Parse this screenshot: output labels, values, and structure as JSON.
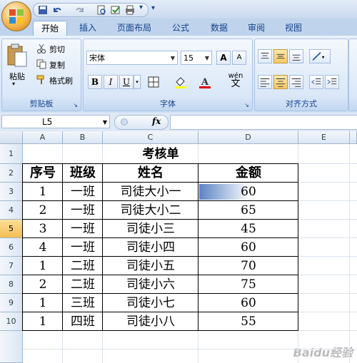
{
  "qat": {
    "dropdown_label": "₹"
  },
  "tabs": [
    "开始",
    "插入",
    "页面布局",
    "公式",
    "数据",
    "审阅",
    "视图"
  ],
  "ribbon": {
    "clipboard": {
      "paste": "粘贴",
      "cut": "剪切",
      "copy": "复制",
      "format_painter": "格式刷",
      "label": "剪贴板"
    },
    "font": {
      "font_name": "宋体",
      "font_size": "15",
      "grow": "A",
      "shrink": "A",
      "bold": "B",
      "italic": "I",
      "underline": "U",
      "phonetic": "wén",
      "phonetic_char": "文",
      "label": "字体"
    },
    "align": {
      "label": "对齐方式"
    }
  },
  "formula_bar": {
    "name_box": "L5",
    "fx": "fx",
    "formula": ""
  },
  "columns": [
    "A",
    "B",
    "C",
    "D",
    "E"
  ],
  "rows": [
    "1",
    "2",
    "3",
    "4",
    "5",
    "6",
    "7",
    "8",
    "9",
    "10"
  ],
  "selected_row": "5",
  "sheet": {
    "title": "考核单",
    "headers": [
      "序号",
      "班级",
      "姓名",
      "金额"
    ],
    "records": [
      {
        "no": "1",
        "cls": "一班",
        "name": "司徒大小一",
        "amount": "60"
      },
      {
        "no": "2",
        "cls": "一班",
        "name": "司徒大小二",
        "amount": "65"
      },
      {
        "no": "3",
        "cls": "一班",
        "name": "司徒小三",
        "amount": "45"
      },
      {
        "no": "4",
        "cls": "一班",
        "name": "司徒小四",
        "amount": "60"
      },
      {
        "no": "1",
        "cls": "二班",
        "name": "司徒小五",
        "amount": "70"
      },
      {
        "no": "2",
        "cls": "二班",
        "name": "司徒小六",
        "amount": "75"
      },
      {
        "no": "1",
        "cls": "三班",
        "name": "司徒小七",
        "amount": "60"
      },
      {
        "no": "1",
        "cls": "四班",
        "name": "司徒小八",
        "amount": "55"
      }
    ],
    "databar_color": "#5b84c4"
  },
  "watermark": "Baidu经验"
}
